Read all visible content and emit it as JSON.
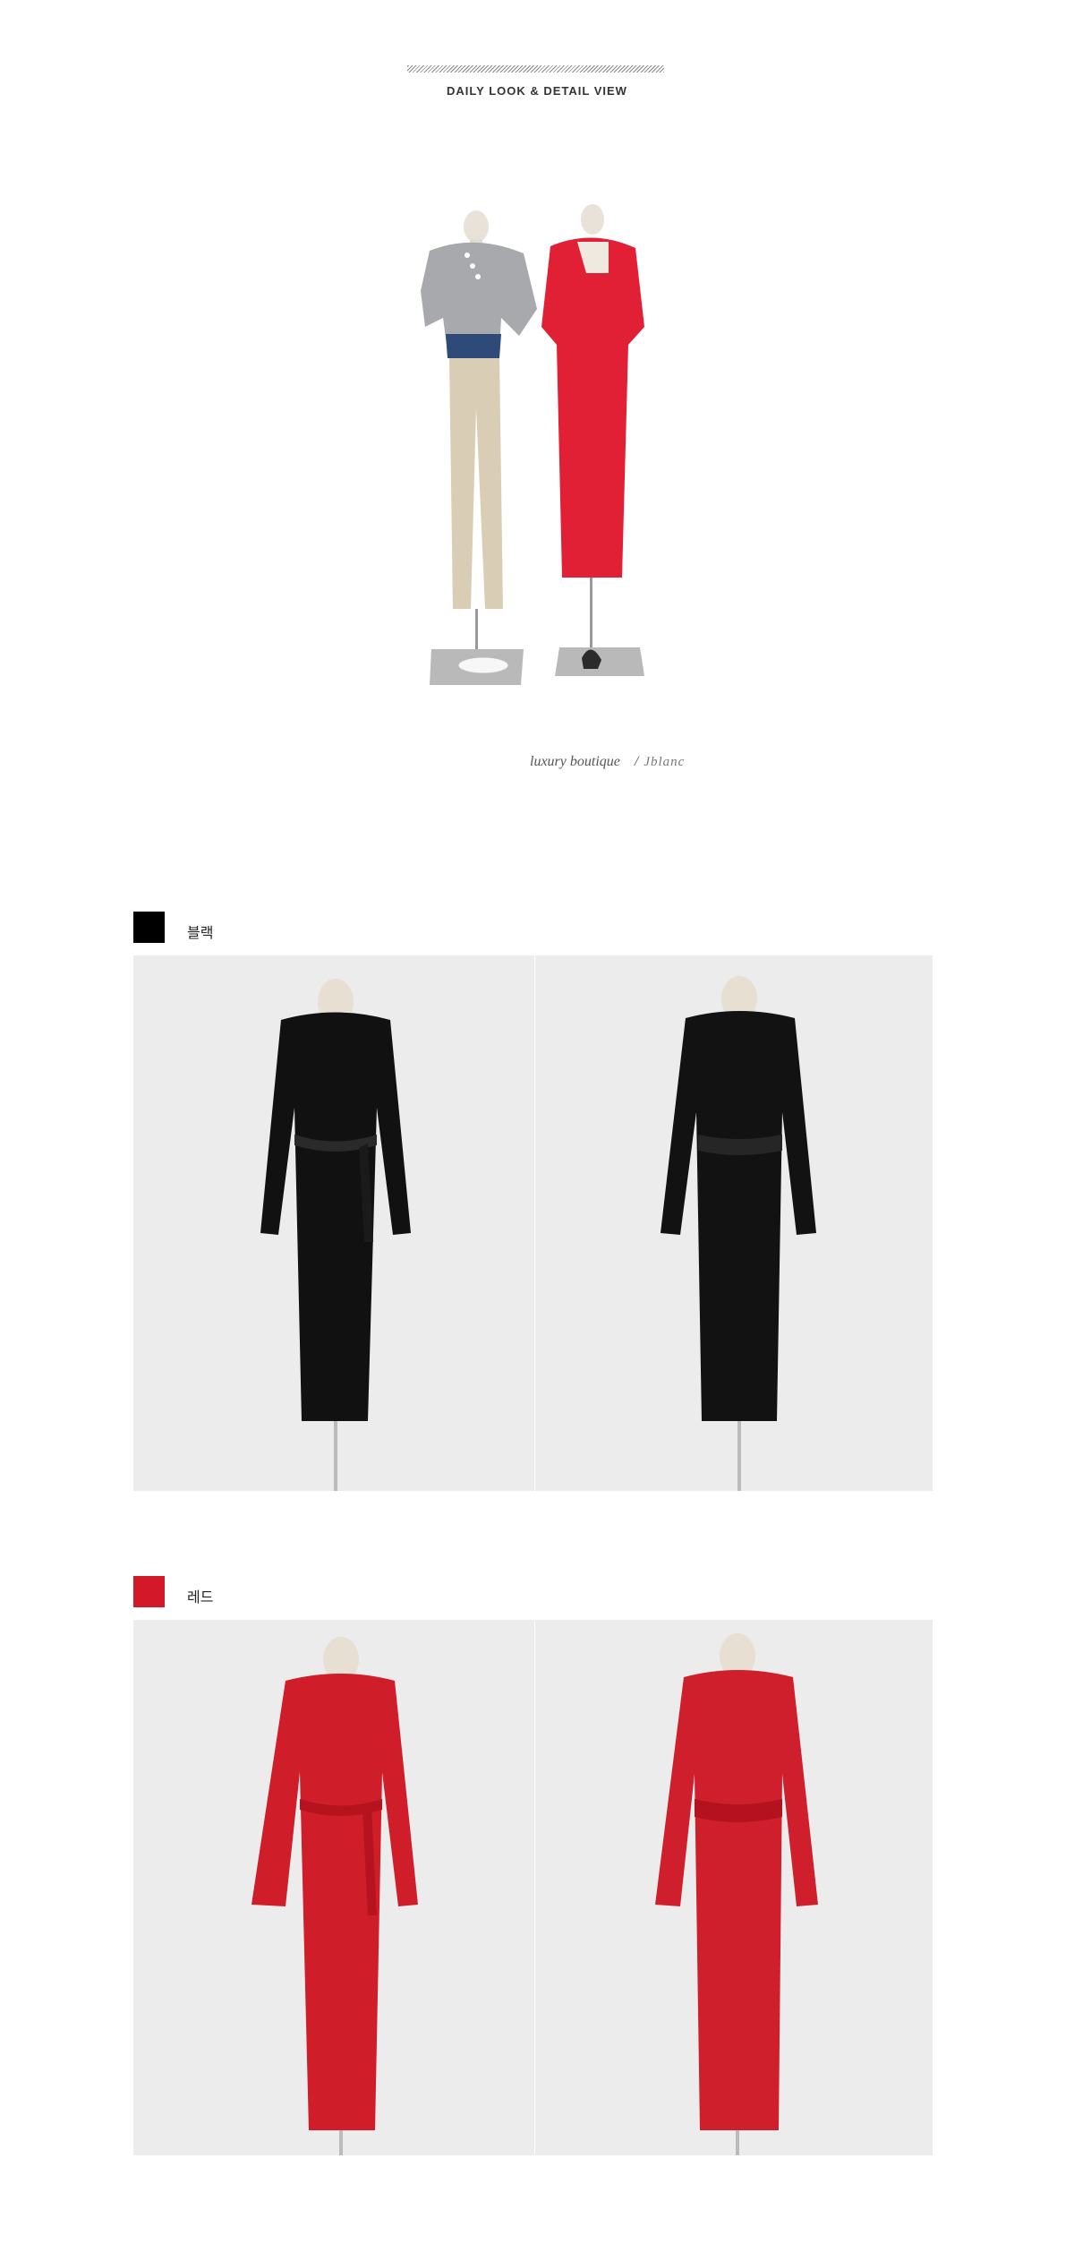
{
  "header": {
    "title": "DAILY LOOK & DETAIL VIEW"
  },
  "brand": {
    "tagline": "luxury boutique",
    "separator": "/",
    "name": "Jblanc"
  },
  "colors_section": [
    {
      "name": "블랙",
      "swatch": "#000000",
      "dress_color": "#111111"
    },
    {
      "name": "레드",
      "swatch": "#d3182a",
      "dress_color": "#cf1d2a"
    }
  ]
}
